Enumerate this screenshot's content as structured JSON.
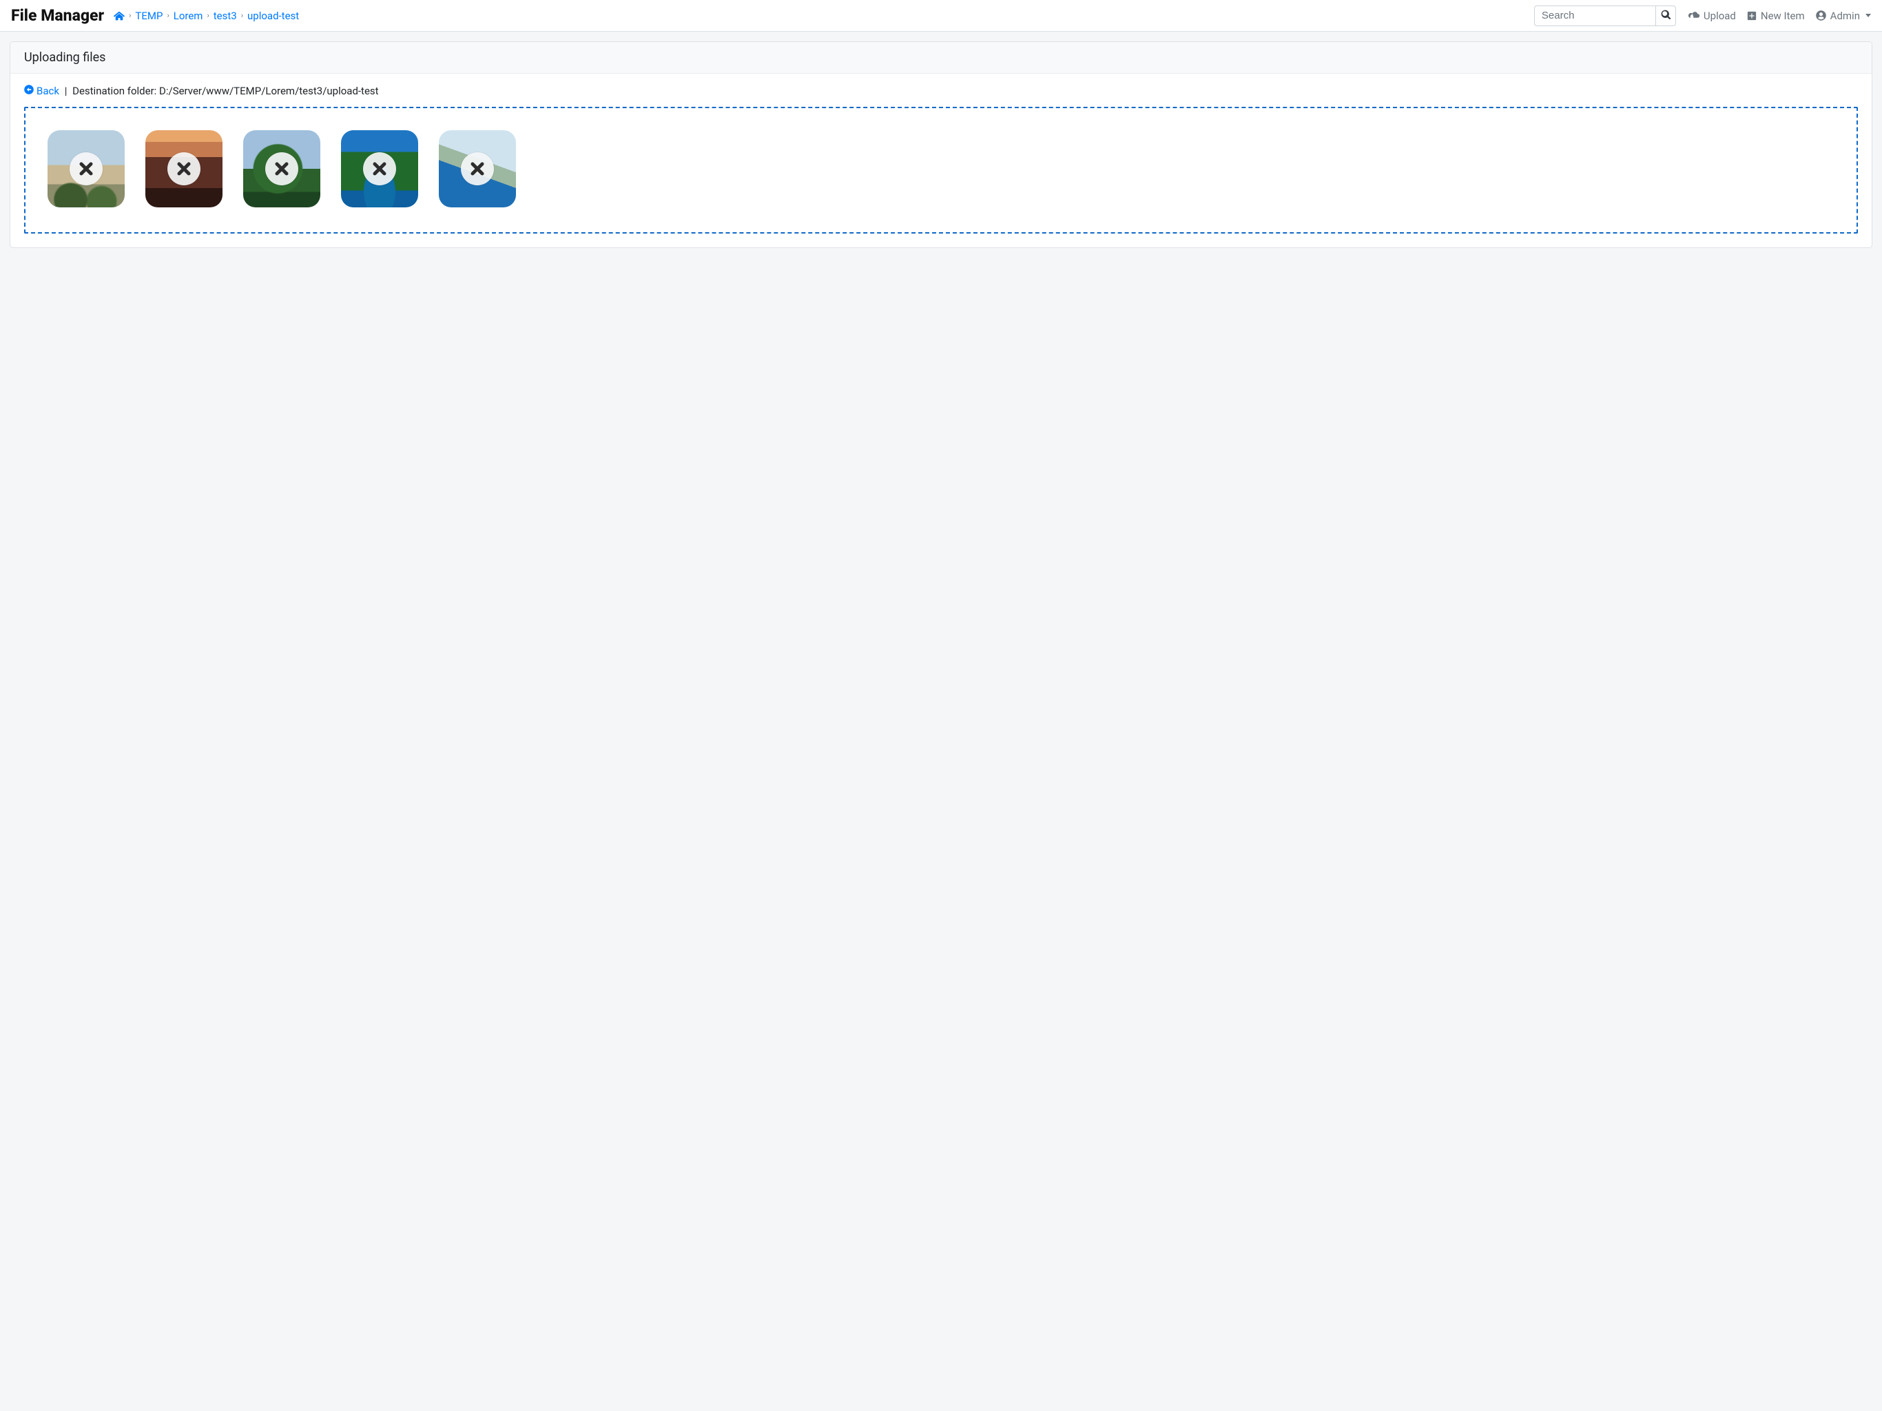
{
  "navbar": {
    "brand": "File Manager",
    "breadcrumb": [
      "TEMP",
      "Lorem",
      "test3",
      "upload-test"
    ],
    "search_placeholder": "Search",
    "upload_label": "Upload",
    "new_item_label": "New Item",
    "user_label": "Admin"
  },
  "card": {
    "header": "Uploading files",
    "back_label": "Back",
    "dest_prefix": "Destination folder: ",
    "dest_path": "D:/Server/www/TEMP/Lorem/test3/upload-test"
  },
  "uploads": {
    "count": 5,
    "remove_icon_stroke": "#2d2d2d",
    "thumbs": [
      "t1",
      "t2",
      "t3",
      "t4",
      "t5"
    ]
  },
  "colors": {
    "link": "#007bff",
    "dropzone_border": "#1069c9"
  }
}
